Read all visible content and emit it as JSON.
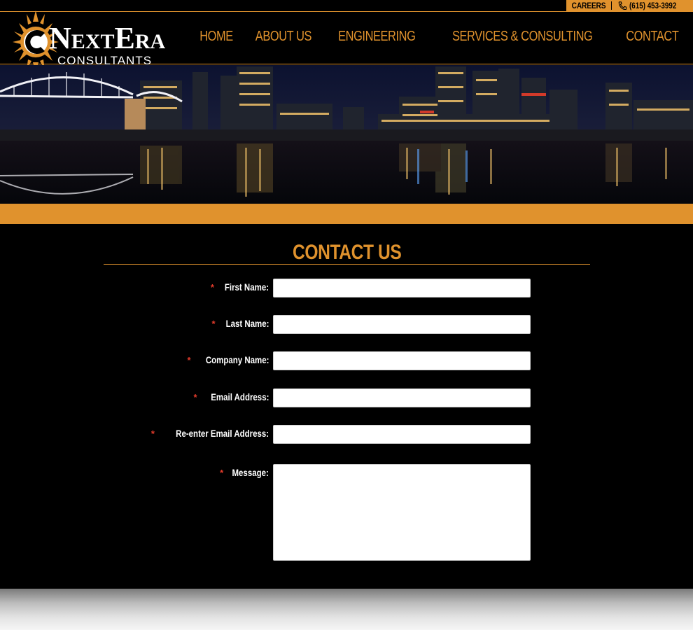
{
  "utility": {
    "careers_label": "CAREERS",
    "phone": "(615) 453-3992",
    "phone_icon": "phone-icon"
  },
  "logo": {
    "word_n": "N",
    "word_ext": "EXT",
    "word_e": "E",
    "word_ra": "RA",
    "subtitle": "CONSULTANTS"
  },
  "nav": {
    "items": [
      {
        "label": "HOME"
      },
      {
        "label": "ABOUT US"
      },
      {
        "label": "ENGINEERING"
      },
      {
        "label": "SERVICES & CONSULTING"
      },
      {
        "label": "CONTACT"
      }
    ]
  },
  "colors": {
    "accent": "#e0922d",
    "background": "#000000",
    "required": "#e23b2b"
  },
  "contact": {
    "title": "CONTACT US",
    "required_marker": "*",
    "fields": [
      {
        "label": "First Name:",
        "value": ""
      },
      {
        "label": "Last Name:",
        "value": ""
      },
      {
        "label": "Company Name:",
        "value": ""
      },
      {
        "label": "Email Address:",
        "value": ""
      },
      {
        "label": "Re-enter Email Address:",
        "value": ""
      },
      {
        "label": "Message:",
        "value": ""
      }
    ]
  }
}
